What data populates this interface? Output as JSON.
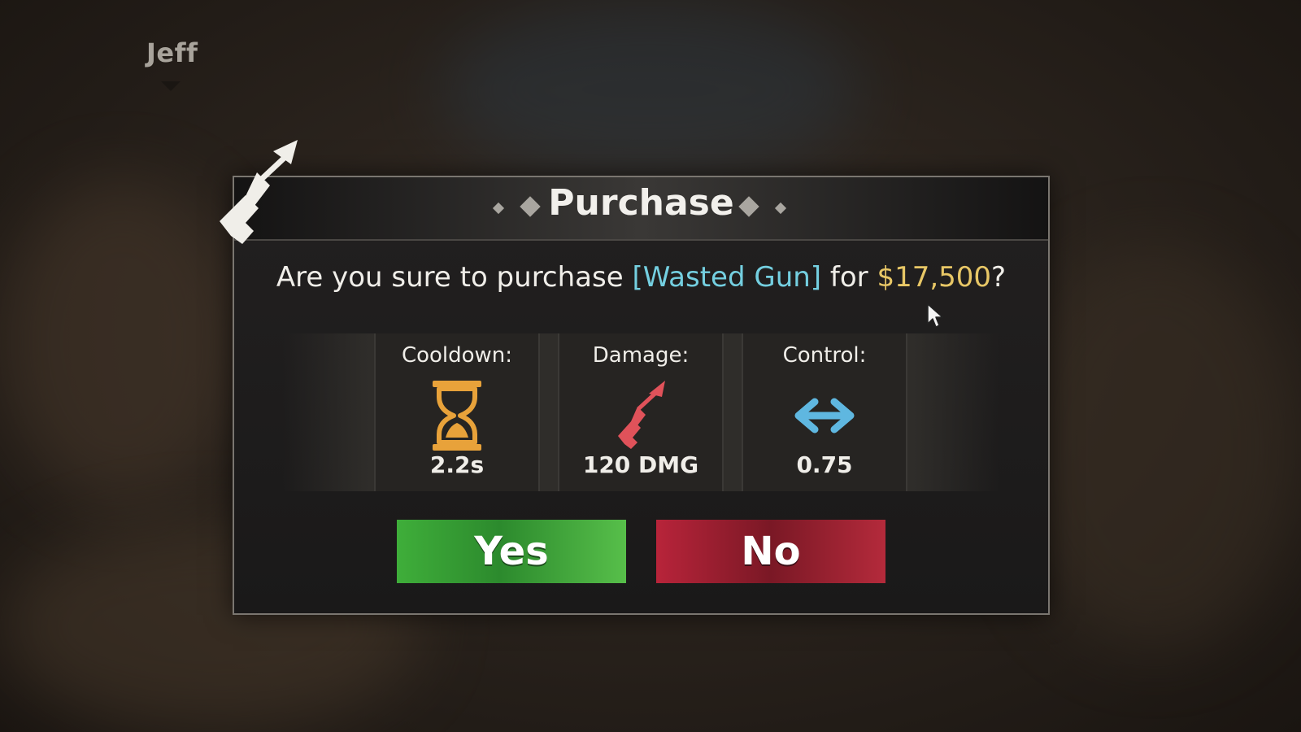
{
  "player": {
    "name": "Jeff"
  },
  "dialog": {
    "title": "Purchase",
    "question_prefix": "Are you sure to purchase ",
    "item_name": "[Wasted Gun]",
    "question_mid": " for ",
    "price": "$17,500",
    "question_suffix": "?"
  },
  "stats": [
    {
      "label": "Cooldown:",
      "value": "2.2s",
      "icon": "hourglass-icon"
    },
    {
      "label": "Damage:",
      "value": "120 DMG",
      "icon": "gun-icon"
    },
    {
      "label": "Control:",
      "value": "0.75",
      "icon": "double-arrow-icon"
    }
  ],
  "buttons": {
    "yes": "Yes",
    "no": "No"
  },
  "colors": {
    "item_name": "#74cfe0",
    "price": "#e8c766",
    "yes_button": "#3fae3a",
    "no_button": "#b8243a",
    "hourglass": "#e8a23a",
    "damage_icon": "#e0525a",
    "control_icon": "#5fb7e0"
  }
}
